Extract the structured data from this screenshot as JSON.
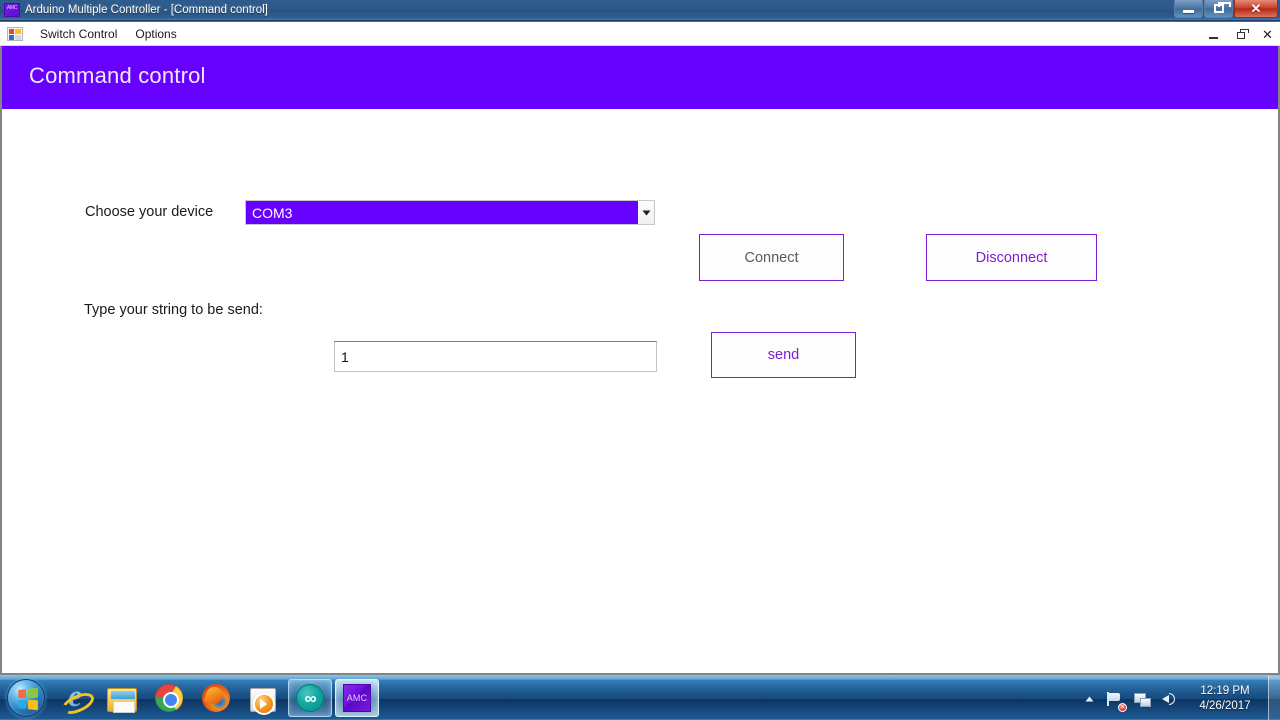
{
  "window": {
    "title": "Arduino Multiple Controller - [Command control]",
    "app_icon": "amc-app-icon",
    "buttons": {
      "minimize": "minimize-icon",
      "maximize": "restore-icon",
      "close": "close-icon",
      "close_glyph": "✕"
    }
  },
  "menubar": {
    "child_icon": "mdi-child-icon",
    "items": [
      {
        "label": "Switch Control"
      },
      {
        "label": "Options"
      }
    ],
    "child_buttons": {
      "minimize": "mdi-minimize-icon",
      "restore": "mdi-restore-icon",
      "close": "mdi-close-icon",
      "close_glyph": "✕"
    }
  },
  "form": {
    "header_title": "Command control",
    "header_color": "#6600ff",
    "accent_color": "#7b1fd1",
    "device_row": {
      "label": "Choose your device",
      "combo": {
        "selected": "COM3",
        "arrow_icon": "chevron-down-icon",
        "selection_bg": "#6600ff",
        "selection_fg": "#ffffff"
      },
      "connect_button": "Connect",
      "disconnect_button": "Disconnect"
    },
    "string_row": {
      "label": "Type your string to be send:",
      "input_value": "1",
      "input_placeholder": "",
      "send_button": "send"
    }
  },
  "taskbar": {
    "start_button": "start-orb-icon",
    "items": [
      {
        "name": "internet-explorer",
        "label": "Internet Explorer",
        "state": "pinned"
      },
      {
        "name": "windows-explorer",
        "label": "Windows Explorer",
        "state": "pinned"
      },
      {
        "name": "google-chrome",
        "label": "Google Chrome",
        "state": "pinned"
      },
      {
        "name": "mozilla-firefox",
        "label": "Mozilla Firefox",
        "state": "pinned"
      },
      {
        "name": "windows-media-player",
        "label": "Windows Media Player",
        "state": "pinned"
      },
      {
        "name": "arduino-ide",
        "label": "Arduino IDE",
        "state": "running",
        "glyph": "∞"
      },
      {
        "name": "amc-app",
        "label": "AMC",
        "state": "active",
        "glyph": "AMC"
      }
    ],
    "tray": {
      "overflow_icon": "chevron-up-icon",
      "action_center_icon": "flag-alert-icon",
      "action_center_badge": "✕",
      "network_icon": "network-icon",
      "volume_icon": "volume-icon",
      "time": "12:19 PM",
      "date": "4/26/2017"
    }
  }
}
